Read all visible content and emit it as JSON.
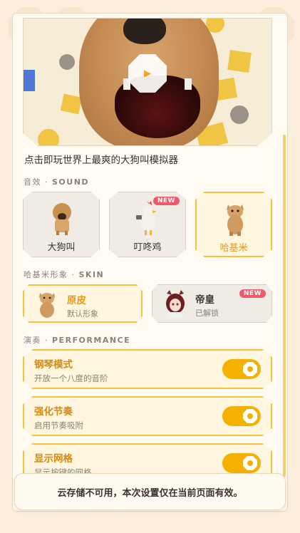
{
  "hero": {
    "tagline": "点击即玩世界上最爽的大狗叫模拟器",
    "play_icon": "play-icon"
  },
  "sound": {
    "section_label_cn": "音效",
    "section_label_en": "SOUND",
    "items": [
      {
        "label": "大狗叫",
        "icon": "dog-icon",
        "active": false,
        "badge": ""
      },
      {
        "label": "叮咚鸡",
        "icon": "chicken-icon",
        "active": false,
        "badge": "NEW"
      },
      {
        "label": "哈基米",
        "icon": "cat-icon",
        "active": true,
        "badge": ""
      }
    ]
  },
  "skin": {
    "section_label_cn": "哈基米形象",
    "section_label_en": "SKIN",
    "items": [
      {
        "title": "原皮",
        "subtitle": "默认形象",
        "icon": "cat-icon",
        "active": true,
        "badge": ""
      },
      {
        "title": "帝皇",
        "subtitle": "已解锁",
        "icon": "horse-girl-icon",
        "active": false,
        "badge": "NEW"
      }
    ]
  },
  "performance": {
    "section_label_cn": "演奏",
    "section_label_en": "PERFORMANCE",
    "items": [
      {
        "title": "钢琴模式",
        "subtitle": "开放一个八度的音阶",
        "enabled": true
      },
      {
        "title": "强化节奏",
        "subtitle": "启用节奏吸附",
        "enabled": true
      },
      {
        "title": "显示网格",
        "subtitle": "显示按键的网格",
        "enabled": true
      }
    ]
  },
  "toast": {
    "message": "云存储不可用，本次设置仅在当前页面有效。"
  },
  "colors": {
    "accent": "#f5b100",
    "accent_border": "#f5c33b",
    "accent_text": "#e39a1f",
    "badge": "#f0596b",
    "background": "#fbeedc"
  }
}
